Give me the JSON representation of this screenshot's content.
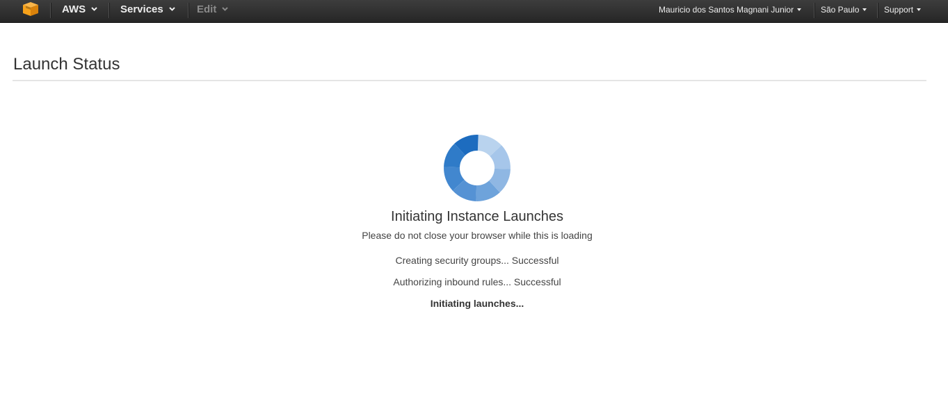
{
  "topbar": {
    "logo_icon": "aws-cube-icon",
    "menus": [
      {
        "label": "AWS"
      },
      {
        "label": "Services"
      },
      {
        "label": "Edit"
      }
    ],
    "user_label": "Mauricio dos Santos Magnani Junior",
    "region_label": "São Paulo",
    "support_label": "Support",
    "colors": {
      "logo": "#f7a21b",
      "bar": "#2e2e2e"
    }
  },
  "page": {
    "title": "Launch Status"
  },
  "status": {
    "spinner_icon": "loading-spinner-icon",
    "heading": "Initiating Instance Launches",
    "subtext": "Please do not close your browser while this is loading",
    "steps": [
      {
        "text": "Creating security groups... Successful"
      },
      {
        "text": "Authorizing inbound rules... Successful"
      },
      {
        "text": "Initiating launches..."
      }
    ],
    "colors": {
      "spinner_dark": "#1f6fc2",
      "spinner_light": "#b8d2ee"
    }
  }
}
